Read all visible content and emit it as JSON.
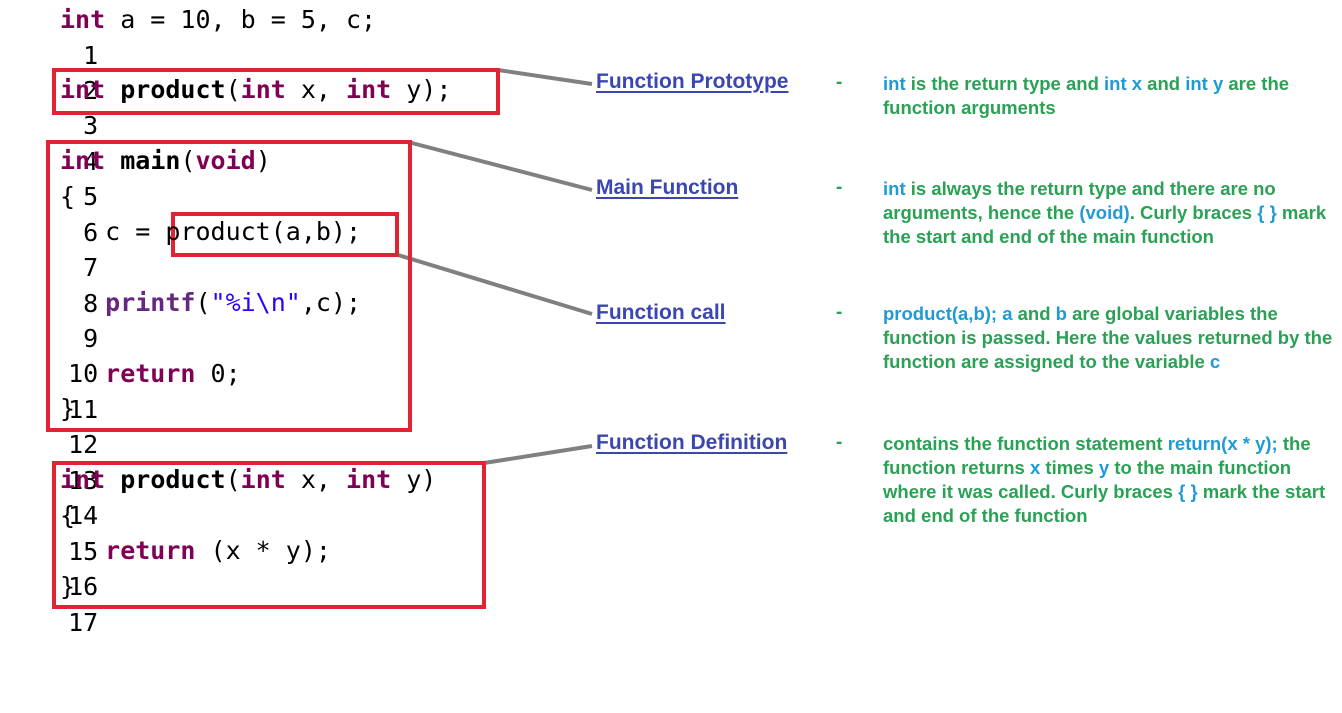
{
  "code": {
    "lines": [
      {
        "n": "1"
      },
      {
        "n": "2"
      },
      {
        "n": "3"
      },
      {
        "n": "4"
      },
      {
        "n": "5"
      },
      {
        "n": "6"
      },
      {
        "n": "7"
      },
      {
        "n": "8"
      },
      {
        "n": "9"
      },
      {
        "n": "10"
      },
      {
        "n": "11"
      },
      {
        "n": "12"
      },
      {
        "n": "13"
      },
      {
        "n": "14"
      },
      {
        "n": "15"
      },
      {
        "n": "16"
      },
      {
        "n": "17"
      }
    ],
    "tokens": {
      "l1": [
        "int",
        " a = 10, b = 5, c;"
      ],
      "l3": [
        "int",
        " ",
        "product",
        "(",
        "int",
        " x, ",
        "int",
        " y);"
      ],
      "l5": [
        "int",
        " ",
        "main",
        "(",
        "void",
        ")"
      ],
      "l6": "{",
      "l7": [
        "   c = ",
        "product(a,b);"
      ],
      "l9": [
        "   ",
        "printf",
        "(",
        "\"%i\\n\"",
        ",c);"
      ],
      "l11": [
        "   ",
        "return",
        " 0;"
      ],
      "l12": "}",
      "l14": [
        "int",
        " ",
        "product",
        "(",
        "int",
        " x, ",
        "int",
        " y)"
      ],
      "l15": "{",
      "l16": [
        "   ",
        "return",
        " (x * y);"
      ],
      "l17": "}"
    }
  },
  "annotations": [
    {
      "label": "Function Prototype",
      "dash": "-",
      "desc": [
        {
          "t": "int",
          "hl": true
        },
        {
          "t": " is the return type and ",
          "hl": false
        },
        {
          "t": "int x",
          "hl": true
        },
        {
          "t": " and ",
          "hl": false
        },
        {
          "t": "int y",
          "hl": true
        },
        {
          "t": " are the function arguments",
          "hl": false
        }
      ]
    },
    {
      "label": "Main Function",
      "dash": "-",
      "desc": [
        {
          "t": "int",
          "hl": true
        },
        {
          "t": " is always the return type and there are no arguments, hence the ",
          "hl": false
        },
        {
          "t": "(void)",
          "hl": true
        },
        {
          "t": ".  Curly braces ",
          "hl": false
        },
        {
          "t": "{ }",
          "hl": true
        },
        {
          "t": " mark the start and end of the main function",
          "hl": false
        }
      ]
    },
    {
      "label": "Function call",
      "dash": "-",
      "desc": [
        {
          "t": "product(a,b); a",
          "hl": true
        },
        {
          "t": " and ",
          "hl": false
        },
        {
          "t": "b",
          "hl": true
        },
        {
          "t": " are global variables the function is passed.  Here the values returned by the function are assigned to the variable ",
          "hl": false
        },
        {
          "t": "c",
          "hl": true
        }
      ]
    },
    {
      "label": "Function Definition",
      "dash": "-",
      "desc": [
        {
          "t": "contains the function statement ",
          "hl": false
        },
        {
          "t": "return(x * y);",
          "hl": true
        },
        {
          "t": " the function returns ",
          "hl": false
        },
        {
          "t": "x",
          "hl": true
        },
        {
          "t": " times ",
          "hl": false
        },
        {
          "t": "y",
          "hl": true
        },
        {
          "t": " to the main function where it was called.  Curly braces ",
          "hl": false
        },
        {
          "t": "{ }",
          "hl": true
        },
        {
          "t": " mark the start and end of the function",
          "hl": false
        }
      ]
    }
  ],
  "colors": {
    "box": "#e02433",
    "connector": "#808080",
    "label": "#3b47b0",
    "desc_text": "#2aa155",
    "desc_highlight": "#1f9ad6",
    "keyword": "#7f0055"
  }
}
